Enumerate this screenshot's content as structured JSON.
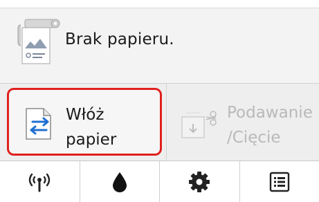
{
  "message": {
    "text": "Brak papieru.",
    "icon": "paper-roll-icon"
  },
  "actions": {
    "load_paper": {
      "label": "Włóż\npapier",
      "icon": "load-paper-icon"
    },
    "feed_cut": {
      "label": "Podawanie\n/Cięcie",
      "icon": "feed-cut-icon",
      "enabled": false
    }
  },
  "toolbar": {
    "items": [
      {
        "name": "wireless",
        "icon": "wireless-icon"
      },
      {
        "name": "ink",
        "icon": "ink-drop-icon"
      },
      {
        "name": "settings",
        "icon": "gear-icon"
      },
      {
        "name": "menu",
        "icon": "list-icon"
      }
    ]
  },
  "colors": {
    "highlight_border": "#e0201d",
    "accent_blue": "#1f6fd1",
    "disabled_text": "#b9b9b9"
  }
}
